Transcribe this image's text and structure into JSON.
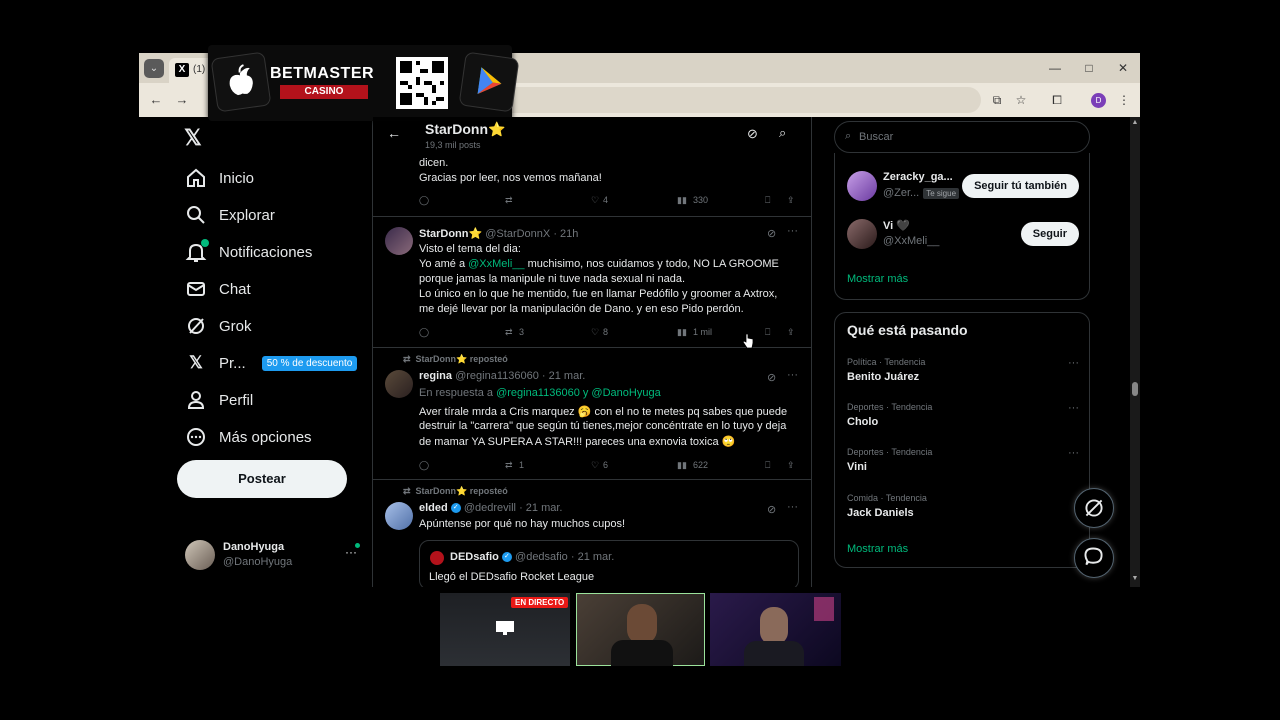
{
  "browser": {
    "tab_title": "(1)",
    "window_controls": {
      "minimize": "—",
      "maximize": "□",
      "close": "✕"
    },
    "profile_initial": "D"
  },
  "ad": {
    "brand": "BETMASTER",
    "sub": "CASINO"
  },
  "leftnav": {
    "items": [
      {
        "label": "Inicio",
        "icon": "home-icon"
      },
      {
        "label": "Explorar",
        "icon": "search-icon"
      },
      {
        "label": "Notificaciones",
        "icon": "bell-icon"
      },
      {
        "label": "Chat",
        "icon": "mail-icon"
      },
      {
        "label": "Grok",
        "icon": "grok-icon"
      },
      {
        "label": "Pr...",
        "icon": "x-logo-icon",
        "badge": "50 % de descuento"
      },
      {
        "label": "Perfil",
        "icon": "person-icon"
      },
      {
        "label": "Más opciones",
        "icon": "more-circle-icon"
      }
    ],
    "post_button": "Postear",
    "account": {
      "name": "DanoHyuga",
      "handle": "@DanoHyuga"
    }
  },
  "header": {
    "title": "StarDonn⭐",
    "subtitle": "19,3 mil posts"
  },
  "tweets": {
    "t0": {
      "lines": [
        "dicen.",
        "Gracias por leer, nos vemos mañana!"
      ],
      "likes": "4",
      "views": "330"
    },
    "t1": {
      "name": "StarDonn⭐",
      "handle": "@StarDonnX",
      "time": "· 21h",
      "line1": "Visto el tema del dia:",
      "line2_a": "Yo amé a ",
      "line2_mention": "@XxMeli__",
      "line2_b": " muchisimo, nos cuidamos y todo, NO LA GROOME",
      "line3": "porque jamas la manipule ni tuve nada sexual ni nada.",
      "line4": "Lo único en lo que he mentido, fue en llamar Pedófilo y groomer a Axtrox,",
      "line5": "me dejé llevar por la manipulación de Dano. y en eso Pido perdón.",
      "retweets": "3",
      "likes": "8",
      "views": "1 mil"
    },
    "t2": {
      "repost": "StarDonn⭐ reposteó",
      "name": "regina",
      "handle": "@regina1136060",
      "time": "· 21 mar.",
      "reply_prefix": "En respuesta a ",
      "reply_mentions": "@regina1136060 y @DanoHyuga",
      "line1": "Aver tírale mrda a Cris marquez 🥱 con el no te metes pq sabes que puede",
      "line2": "destruir la \"carrera\" que según tú tienes,mejor concéntrate en lo tuyo y deja",
      "line3": "de mamar YA SUPERA A STAR!!! pareces una exnovia toxica 🙄",
      "retweets": "1",
      "likes": "6",
      "views": "622"
    },
    "t3": {
      "repost": "StarDonn⭐ reposteó",
      "name": "elded",
      "handle": "@dedrevill",
      "time": "· 21 mar.",
      "line1": "Apúntense por qué no hay muchos cupos!",
      "quote_name": "DEDsafio",
      "quote_handle": "@dedsafio",
      "quote_time": "· 21 mar.",
      "quote_text": "Llegó el DEDsafio Rocket League"
    }
  },
  "rightcol": {
    "search_placeholder": "Buscar",
    "follow": [
      {
        "name": "Zeracky_ga...",
        "handle": "@Zer...",
        "tag": "Te sigue",
        "button": "Seguir tú también"
      },
      {
        "name": "Vi 🖤",
        "handle": "@XxMeli__",
        "button": "Seguir"
      }
    ],
    "show_more": "Mostrar más",
    "trends_title": "Qué está pasando",
    "trends": [
      {
        "category": "Política · Tendencia",
        "title": "Benito Juárez"
      },
      {
        "category": "Deportes · Tendencia",
        "title": "Cholo"
      },
      {
        "category": "Deportes · Tendencia",
        "title": "Vini"
      },
      {
        "category": "Comida · Tendencia",
        "title": "Jack Daniels"
      }
    ],
    "trends_show_more": "Mostrar más"
  },
  "stream": {
    "live_label": "EN DIRECTO"
  },
  "colors": {
    "accent_green": "#00ba7c",
    "x_blue": "#1d9bf0",
    "background": "#000000",
    "border": "#2f3336"
  }
}
